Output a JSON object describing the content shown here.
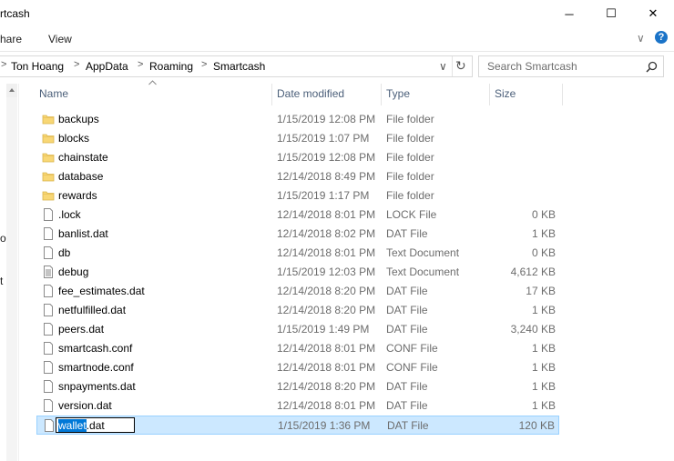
{
  "window": {
    "title": "rtcash",
    "minimize_glyph": "─",
    "maximize_glyph": "☐",
    "close_glyph": "✕"
  },
  "ribbon": {
    "tabs": [
      "hare",
      "View"
    ],
    "expand_glyph": "∨",
    "help_glyph": "?"
  },
  "address": {
    "crumbs": [
      "Ton Hoang",
      "AppData",
      "Roaming",
      "Smartcash"
    ],
    "separator": ">",
    "dropdown_glyph": "∨",
    "refresh_glyph": "↻"
  },
  "search": {
    "placeholder": "Search Smartcash"
  },
  "navpane": {
    "fragments": [
      "o",
      "t"
    ]
  },
  "columns": {
    "name": "Name",
    "date": "Date modified",
    "type": "Type",
    "size": "Size"
  },
  "rename": {
    "selected": "wallet",
    "rest": ".dat"
  },
  "files": [
    {
      "name": "backups",
      "date": "1/15/2019 12:08 PM",
      "type": "File folder",
      "size": "",
      "icon": "folder"
    },
    {
      "name": "blocks",
      "date": "1/15/2019 1:07 PM",
      "type": "File folder",
      "size": "",
      "icon": "folder"
    },
    {
      "name": "chainstate",
      "date": "1/15/2019 12:08 PM",
      "type": "File folder",
      "size": "",
      "icon": "folder"
    },
    {
      "name": "database",
      "date": "12/14/2018 8:49 PM",
      "type": "File folder",
      "size": "",
      "icon": "folder"
    },
    {
      "name": "rewards",
      "date": "1/15/2019 1:17 PM",
      "type": "File folder",
      "size": "",
      "icon": "folder"
    },
    {
      "name": ".lock",
      "date": "12/14/2018 8:01 PM",
      "type": "LOCK File",
      "size": "0 KB",
      "icon": "file"
    },
    {
      "name": "banlist.dat",
      "date": "12/14/2018 8:02 PM",
      "type": "DAT File",
      "size": "1 KB",
      "icon": "file"
    },
    {
      "name": "db",
      "date": "12/14/2018 8:01 PM",
      "type": "Text Document",
      "size": "0 KB",
      "icon": "file"
    },
    {
      "name": "debug",
      "date": "1/15/2019 12:03 PM",
      "type": "Text Document",
      "size": "4,612 KB",
      "icon": "text"
    },
    {
      "name": "fee_estimates.dat",
      "date": "12/14/2018 8:20 PM",
      "type": "DAT File",
      "size": "17 KB",
      "icon": "file"
    },
    {
      "name": "netfulfilled.dat",
      "date": "12/14/2018 8:20 PM",
      "type": "DAT File",
      "size": "1 KB",
      "icon": "file"
    },
    {
      "name": "peers.dat",
      "date": "1/15/2019 1:49 PM",
      "type": "DAT File",
      "size": "3,240 KB",
      "icon": "file"
    },
    {
      "name": "smartcash.conf",
      "date": "12/14/2018 8:01 PM",
      "type": "CONF File",
      "size": "1 KB",
      "icon": "file"
    },
    {
      "name": "smartnode.conf",
      "date": "12/14/2018 8:01 PM",
      "type": "CONF File",
      "size": "1 KB",
      "icon": "file"
    },
    {
      "name": "snpayments.dat",
      "date": "12/14/2018 8:20 PM",
      "type": "DAT File",
      "size": "1 KB",
      "icon": "file"
    },
    {
      "name": "version.dat",
      "date": "12/14/2018 8:01 PM",
      "type": "DAT File",
      "size": "1 KB",
      "icon": "file"
    },
    {
      "name": "wallet.dat",
      "date": "1/15/2019 1:36 PM",
      "type": "DAT File",
      "size": "120 KB",
      "icon": "file",
      "selected": true,
      "renaming": true
    }
  ]
}
